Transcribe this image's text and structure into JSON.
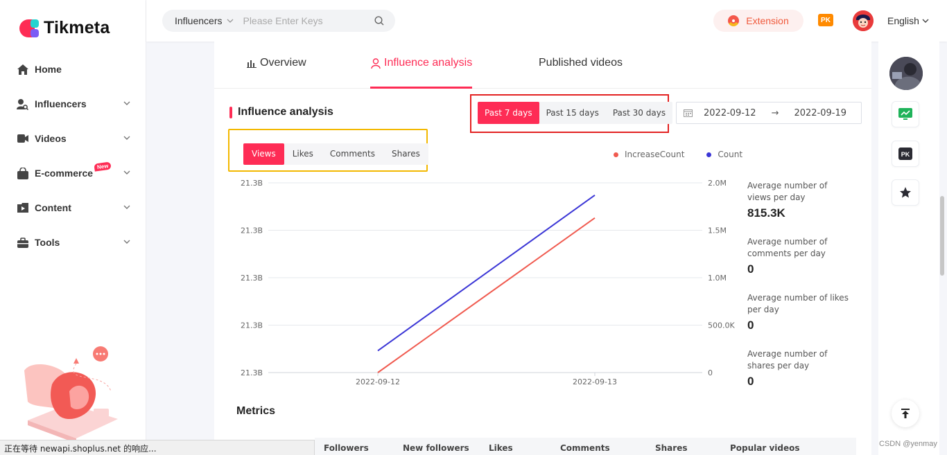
{
  "brand": {
    "name": "Tikmeta"
  },
  "sidebar": {
    "items": [
      {
        "label": "Home",
        "icon": "home-icon",
        "has_chevron": false
      },
      {
        "label": "Influencers",
        "icon": "influencer-search-icon",
        "has_chevron": true
      },
      {
        "label": "Videos",
        "icon": "video-camera-icon",
        "has_chevron": true
      },
      {
        "label": "E-commerce",
        "icon": "shopping-bag-icon",
        "has_chevron": true,
        "badge": "New"
      },
      {
        "label": "Content",
        "icon": "folder-play-icon",
        "has_chevron": true
      },
      {
        "label": "Tools",
        "icon": "toolbox-icon",
        "has_chevron": true
      }
    ]
  },
  "header": {
    "search_scope": "Influencers",
    "search_placeholder": "Please Enter Keys",
    "extension_label": "Extension",
    "pk_label": "PK",
    "language": "English"
  },
  "tabs": [
    {
      "label": "Overview",
      "icon": "bar-chart-icon",
      "active": false
    },
    {
      "label": "Influence analysis",
      "icon": "user-icon",
      "active": true
    },
    {
      "label": "Published videos",
      "icon": "",
      "active": false
    }
  ],
  "section": {
    "title": "Influence analysis"
  },
  "period_options": [
    {
      "label": "Past 7 days",
      "active": true
    },
    {
      "label": "Past 15 days",
      "active": false
    },
    {
      "label": "Past 30 days",
      "active": false
    }
  ],
  "date_range": {
    "start": "2022-09-12",
    "end": "2022-09-19",
    "separator": "→"
  },
  "metric_options": [
    {
      "label": "Views",
      "active": true
    },
    {
      "label": "Likes",
      "active": false
    },
    {
      "label": "Comments",
      "active": false
    },
    {
      "label": "Shares",
      "active": false
    }
  ],
  "colors": {
    "accent": "#fe2c55",
    "increase": "#f05a4f",
    "count": "#3b36d6",
    "period_highlight": "#e32121",
    "metric_highlight": "#f3b800"
  },
  "chart_data": {
    "type": "line",
    "x": [
      "2022-09-12",
      "2022-09-13"
    ],
    "left_axis_ticks": [
      "21.3B",
      "21.3B",
      "21.3B",
      "21.3B",
      "21.3B"
    ],
    "right_axis_ticks": [
      "2.0M",
      "1.5M",
      "1.0M",
      "500.0K",
      "0"
    ],
    "right_ylim": [
      0,
      2000000
    ],
    "grid": true,
    "legend_position": "top-right",
    "series": [
      {
        "name": "IncreaseCount",
        "axis": "right",
        "values": [
          0,
          1630000
        ],
        "color": "#f05a4f"
      },
      {
        "name": "Count",
        "axis": "right",
        "values": [
          230000,
          1870000
        ],
        "color": "#3b36d6"
      }
    ]
  },
  "stats": [
    {
      "label": "Average number of views per day",
      "value": "815.3K"
    },
    {
      "label": "Average number of comments per day",
      "value": "0"
    },
    {
      "label": "Average number of likes per day",
      "value": "0"
    },
    {
      "label": "Average number of shares per day",
      "value": "0"
    }
  ],
  "metrics": {
    "title": "Metrics",
    "columns": [
      "Followers",
      "New followers",
      "Likes",
      "Comments",
      "Shares",
      "Popular videos"
    ]
  },
  "status_bar": "正在等待 newapi.shoplus.net 的响应...",
  "watermark": "CSDN @yenmay"
}
